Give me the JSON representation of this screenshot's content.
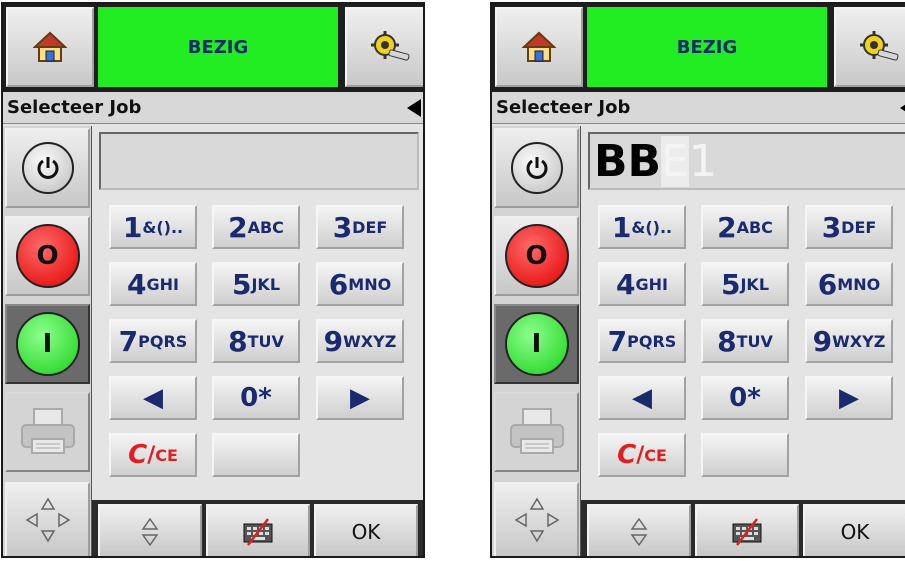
{
  "left_panel": {
    "status": "BEZIG",
    "title": "Selecteer Job",
    "entry_value": "",
    "keys": {
      "k1": {
        "main": "1",
        "sub": "&().."
      },
      "k2": {
        "main": "2",
        "sub": "ABC"
      },
      "k3": {
        "main": "3",
        "sub": "DEF"
      },
      "k4": {
        "main": "4",
        "sub": "GHI"
      },
      "k5": {
        "main": "5",
        "sub": "JKL"
      },
      "k6": {
        "main": "6",
        "sub": "MNO"
      },
      "k7": {
        "main": "7",
        "sub": "PQRS"
      },
      "k8": {
        "main": "8",
        "sub": "TUV"
      },
      "k9": {
        "main": "9",
        "sub": "WXYZ"
      },
      "left": "◀",
      "zero": "0*",
      "right": "▶",
      "ce_main": "C",
      "ce_sub": "CE"
    },
    "stop_label": "O",
    "start_label": "I",
    "ok": "OK"
  },
  "right_panel": {
    "status": "BEZIG",
    "title": "Selecteer Job",
    "entry_typed": "BB",
    "entry_cursor": "E",
    "entry_rest": "1",
    "keys": {
      "k1": {
        "main": "1",
        "sub": "&().."
      },
      "k2": {
        "main": "2",
        "sub": "ABC"
      },
      "k3": {
        "main": "3",
        "sub": "DEF"
      },
      "k4": {
        "main": "4",
        "sub": "GHI"
      },
      "k5": {
        "main": "5",
        "sub": "JKL"
      },
      "k6": {
        "main": "6",
        "sub": "MNO"
      },
      "k7": {
        "main": "7",
        "sub": "PQRS"
      },
      "k8": {
        "main": "8",
        "sub": "TUV"
      },
      "k9": {
        "main": "9",
        "sub": "WXYZ"
      },
      "left": "◀",
      "zero": "0*",
      "right": "▶",
      "ce_main": "C",
      "ce_sub": "CE"
    },
    "stop_label": "O",
    "start_label": "I",
    "ok": "OK"
  },
  "colors": {
    "status_green": "#22ec22",
    "key_text": "#1a2a6e",
    "ce_red": "#e02020",
    "stop_red": "#e00000",
    "start_green": "#18d018"
  },
  "icons": [
    "home-icon",
    "settings-gear-icon",
    "power-icon",
    "printer-icon",
    "direction-pad-icon",
    "scroll-updown-icon",
    "keyboard-disabled-icon"
  ]
}
